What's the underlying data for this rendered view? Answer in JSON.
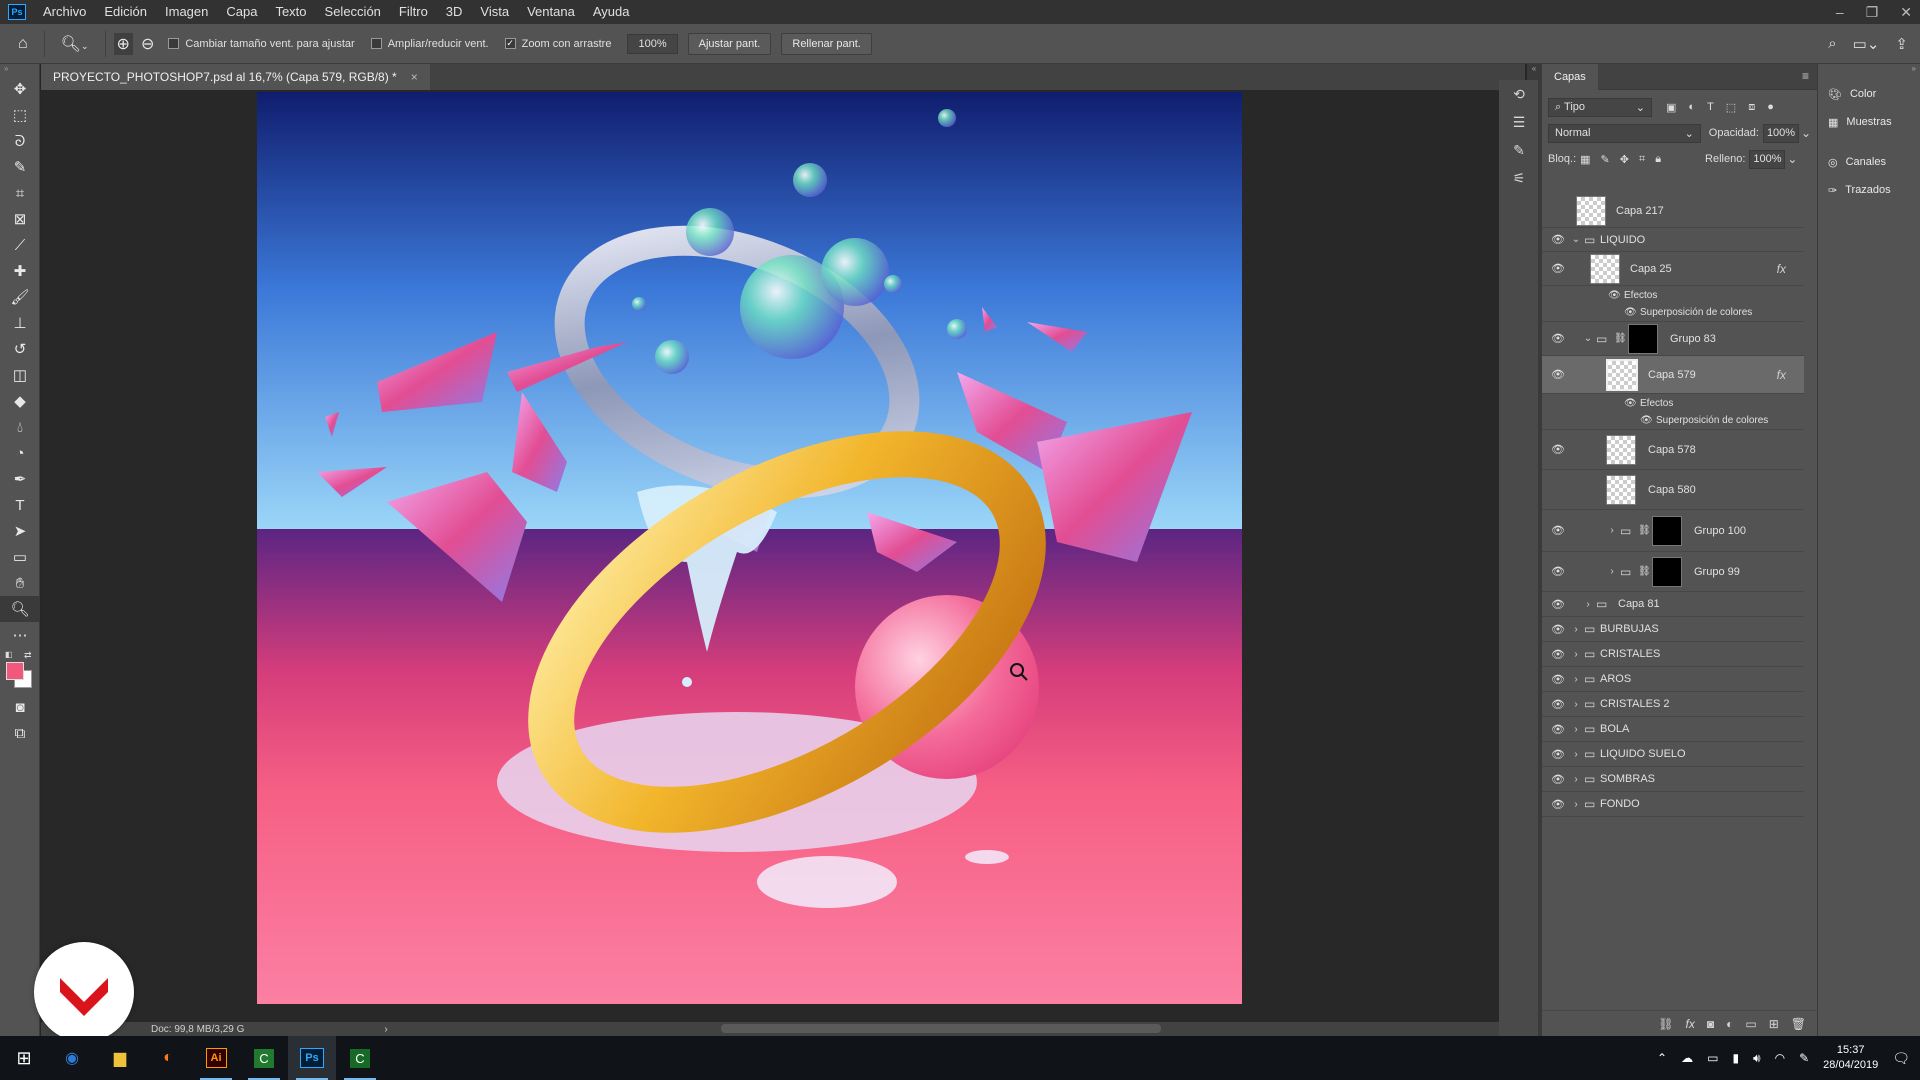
{
  "app": {
    "logo": "Ps"
  },
  "menu": [
    "Archivo",
    "Edición",
    "Imagen",
    "Capa",
    "Texto",
    "Selección",
    "Filtro",
    "3D",
    "Vista",
    "Ventana",
    "Ayuda"
  ],
  "options": {
    "check_resize": "Cambiar tamaño vent. para ajustar",
    "check_zoom_all": "Ampliar/reducir vent.",
    "check_scrubby": "Zoom con arrastre",
    "zoom_value": "100%",
    "fit_button": "Ajustar pant.",
    "fill_button": "Rellenar pant."
  },
  "document": {
    "tab_title": "PROYECTO_PHOTOSHOP7.psd al 16,7% (Capa 579, RGB/8) *",
    "status": "Doc: 99,8 MB/3,29 G"
  },
  "layers_panel": {
    "tab": "Capas",
    "filter_kind": "Tipo",
    "blend_mode": "Normal",
    "opacity_label": "Opacidad:",
    "opacity_value": "100%",
    "lock_label": "Bloq.:",
    "fill_label": "Relleno:",
    "fill_value": "100%",
    "layers": [
      {
        "name": "Capa 217"
      },
      {
        "name": "LIQUIDO"
      },
      {
        "name": "Capa 25"
      },
      {
        "name": "Efectos"
      },
      {
        "name": "Superposición de colores"
      },
      {
        "name": "Grupo 83"
      },
      {
        "name": "Capa 579"
      },
      {
        "name": "Efectos"
      },
      {
        "name": "Superposición de colores"
      },
      {
        "name": "Capa 578"
      },
      {
        "name": "Capa 580"
      },
      {
        "name": "Grupo 100"
      },
      {
        "name": "Grupo 99"
      },
      {
        "name": "Capa 81"
      },
      {
        "name": "BURBUJAS"
      },
      {
        "name": "CRISTALES"
      },
      {
        "name": "AROS"
      },
      {
        "name": "CRISTALES 2"
      },
      {
        "name": "BOLA"
      },
      {
        "name": "LIQUIDO SUELO"
      },
      {
        "name": "SOMBRAS"
      },
      {
        "name": "FONDO"
      }
    ]
  },
  "dock": {
    "color": "Color",
    "swatches": "Muestras",
    "channels": "Canales",
    "paths": "Trazados"
  },
  "taskbar": {
    "time": "15:37",
    "date": "28/04/2019"
  },
  "colors": {
    "foreground": "#f2577c",
    "background": "#ffffff",
    "accent": "#31a8ff"
  }
}
